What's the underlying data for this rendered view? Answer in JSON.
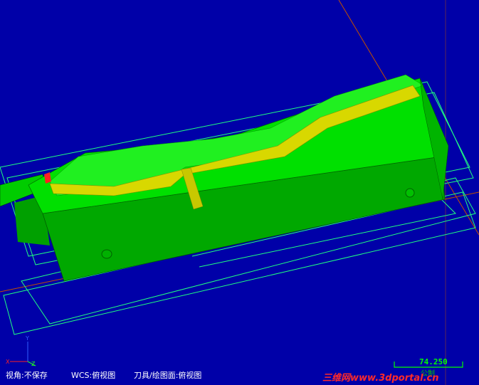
{
  "status_bar": {
    "view": "视角:不保存",
    "wcs": "WCS:俯视图",
    "tool_plane": "刀具/绘图面:俯视图"
  },
  "scale": {
    "value": "74.250",
    "unit": "公制"
  },
  "axis_triad": {
    "x_label": "X",
    "y_label": "Y",
    "z_label": "Z"
  },
  "watermark": {
    "text": "三维网www.3dportal.cn"
  },
  "colors": {
    "background": "#0000a8",
    "model_light": "#00ee00",
    "model_dark": "#009a00",
    "channel": "#e0e000",
    "wireframe": "#00ff80",
    "axis_line": "#c05000"
  }
}
